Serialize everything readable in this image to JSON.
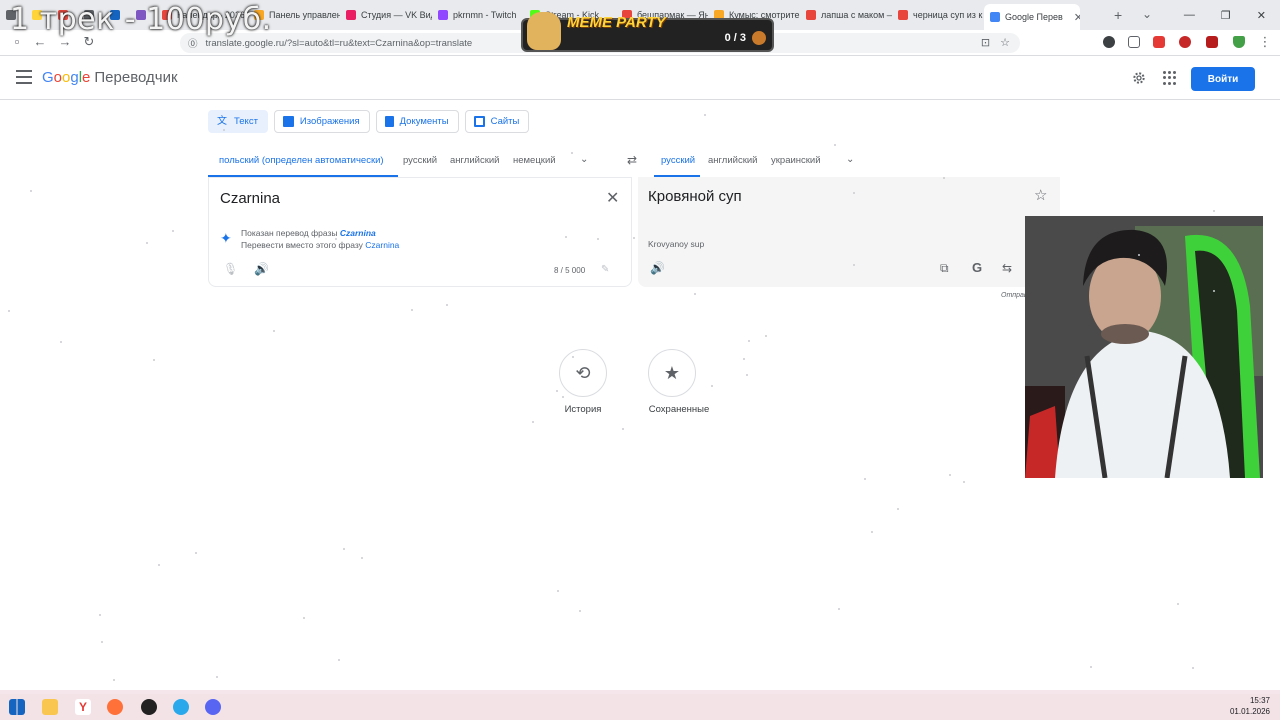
{
  "overlay": {
    "title": "1 трек - 100руб.",
    "meme_title": "MEME PARTY",
    "meme_score": "0 / 3"
  },
  "browser": {
    "tabs": [
      {
        "label": "",
        "color": "#5f6368"
      },
      {
        "label": "",
        "color": "#ffd43b"
      },
      {
        "label": "",
        "color": "#e8453c"
      },
      {
        "label": "",
        "color": "#5f6368"
      },
      {
        "label": "",
        "color": "#1565c0"
      },
      {
        "label": "",
        "color": "#7e57c2"
      },
      {
        "label": "Календарь 2026",
        "color": "#e8453c"
      },
      {
        "label": "Панель управлен",
        "color": "#f9a825"
      },
      {
        "label": "Студия — VK Вид",
        "color": "#e91e63"
      },
      {
        "label": "pkrnmn - Twitch",
        "color": "#9146ff"
      },
      {
        "label": "Stream - Kick",
        "color": "#53fc18"
      },
      {
        "label": "бешпармак — Ян",
        "color": "#e8453c"
      },
      {
        "label": "Кумыс: смотрите",
        "color": "#f9a825"
      },
      {
        "label": "лапша с маком —",
        "color": "#e8453c"
      },
      {
        "label": "черница суп из к",
        "color": "#e8453c"
      },
      {
        "label": "Google Перев",
        "color": "#4285f4",
        "active": true
      }
    ],
    "url": "translate.google.ru/?sl=auto&tl=ru&text=Czarnina&op=translate"
  },
  "header": {
    "logo_letters": [
      {
        "ch": "G",
        "color": "#4285f4"
      },
      {
        "ch": "o",
        "color": "#ea4335"
      },
      {
        "ch": "o",
        "color": "#fbbc05"
      },
      {
        "ch": "g",
        "color": "#4285f4"
      },
      {
        "ch": "l",
        "color": "#34a853"
      },
      {
        "ch": "e",
        "color": "#ea4335"
      }
    ],
    "product": "Переводчик",
    "signin_label": "Войти"
  },
  "modes": {
    "text": "Текст",
    "images": "Изображения",
    "documents": "Документы",
    "sites": "Сайты"
  },
  "source_langs": {
    "detected": "польский (определен автоматически)",
    "l1": "русский",
    "l2": "английский",
    "l3": "немецкий"
  },
  "target_langs": {
    "l1": "русский",
    "l2": "английский",
    "l3": "украинский"
  },
  "source": {
    "text": "Czarnina",
    "shown_prefix": "Показан перевод фразы ",
    "shown_word": "Czarnina",
    "instead_prefix": "Перевести вместо этого фразу ",
    "instead_word": "Czarnina",
    "char_count": "8 / 5 000"
  },
  "target": {
    "text": "Кровяной суп",
    "transliteration": "Krovyanoy sup",
    "feedback": "Отправ"
  },
  "actions": {
    "history": "История",
    "saved": "Сохраненные"
  },
  "taskbar": {
    "time": "15:37",
    "date": "01.01.2026"
  }
}
